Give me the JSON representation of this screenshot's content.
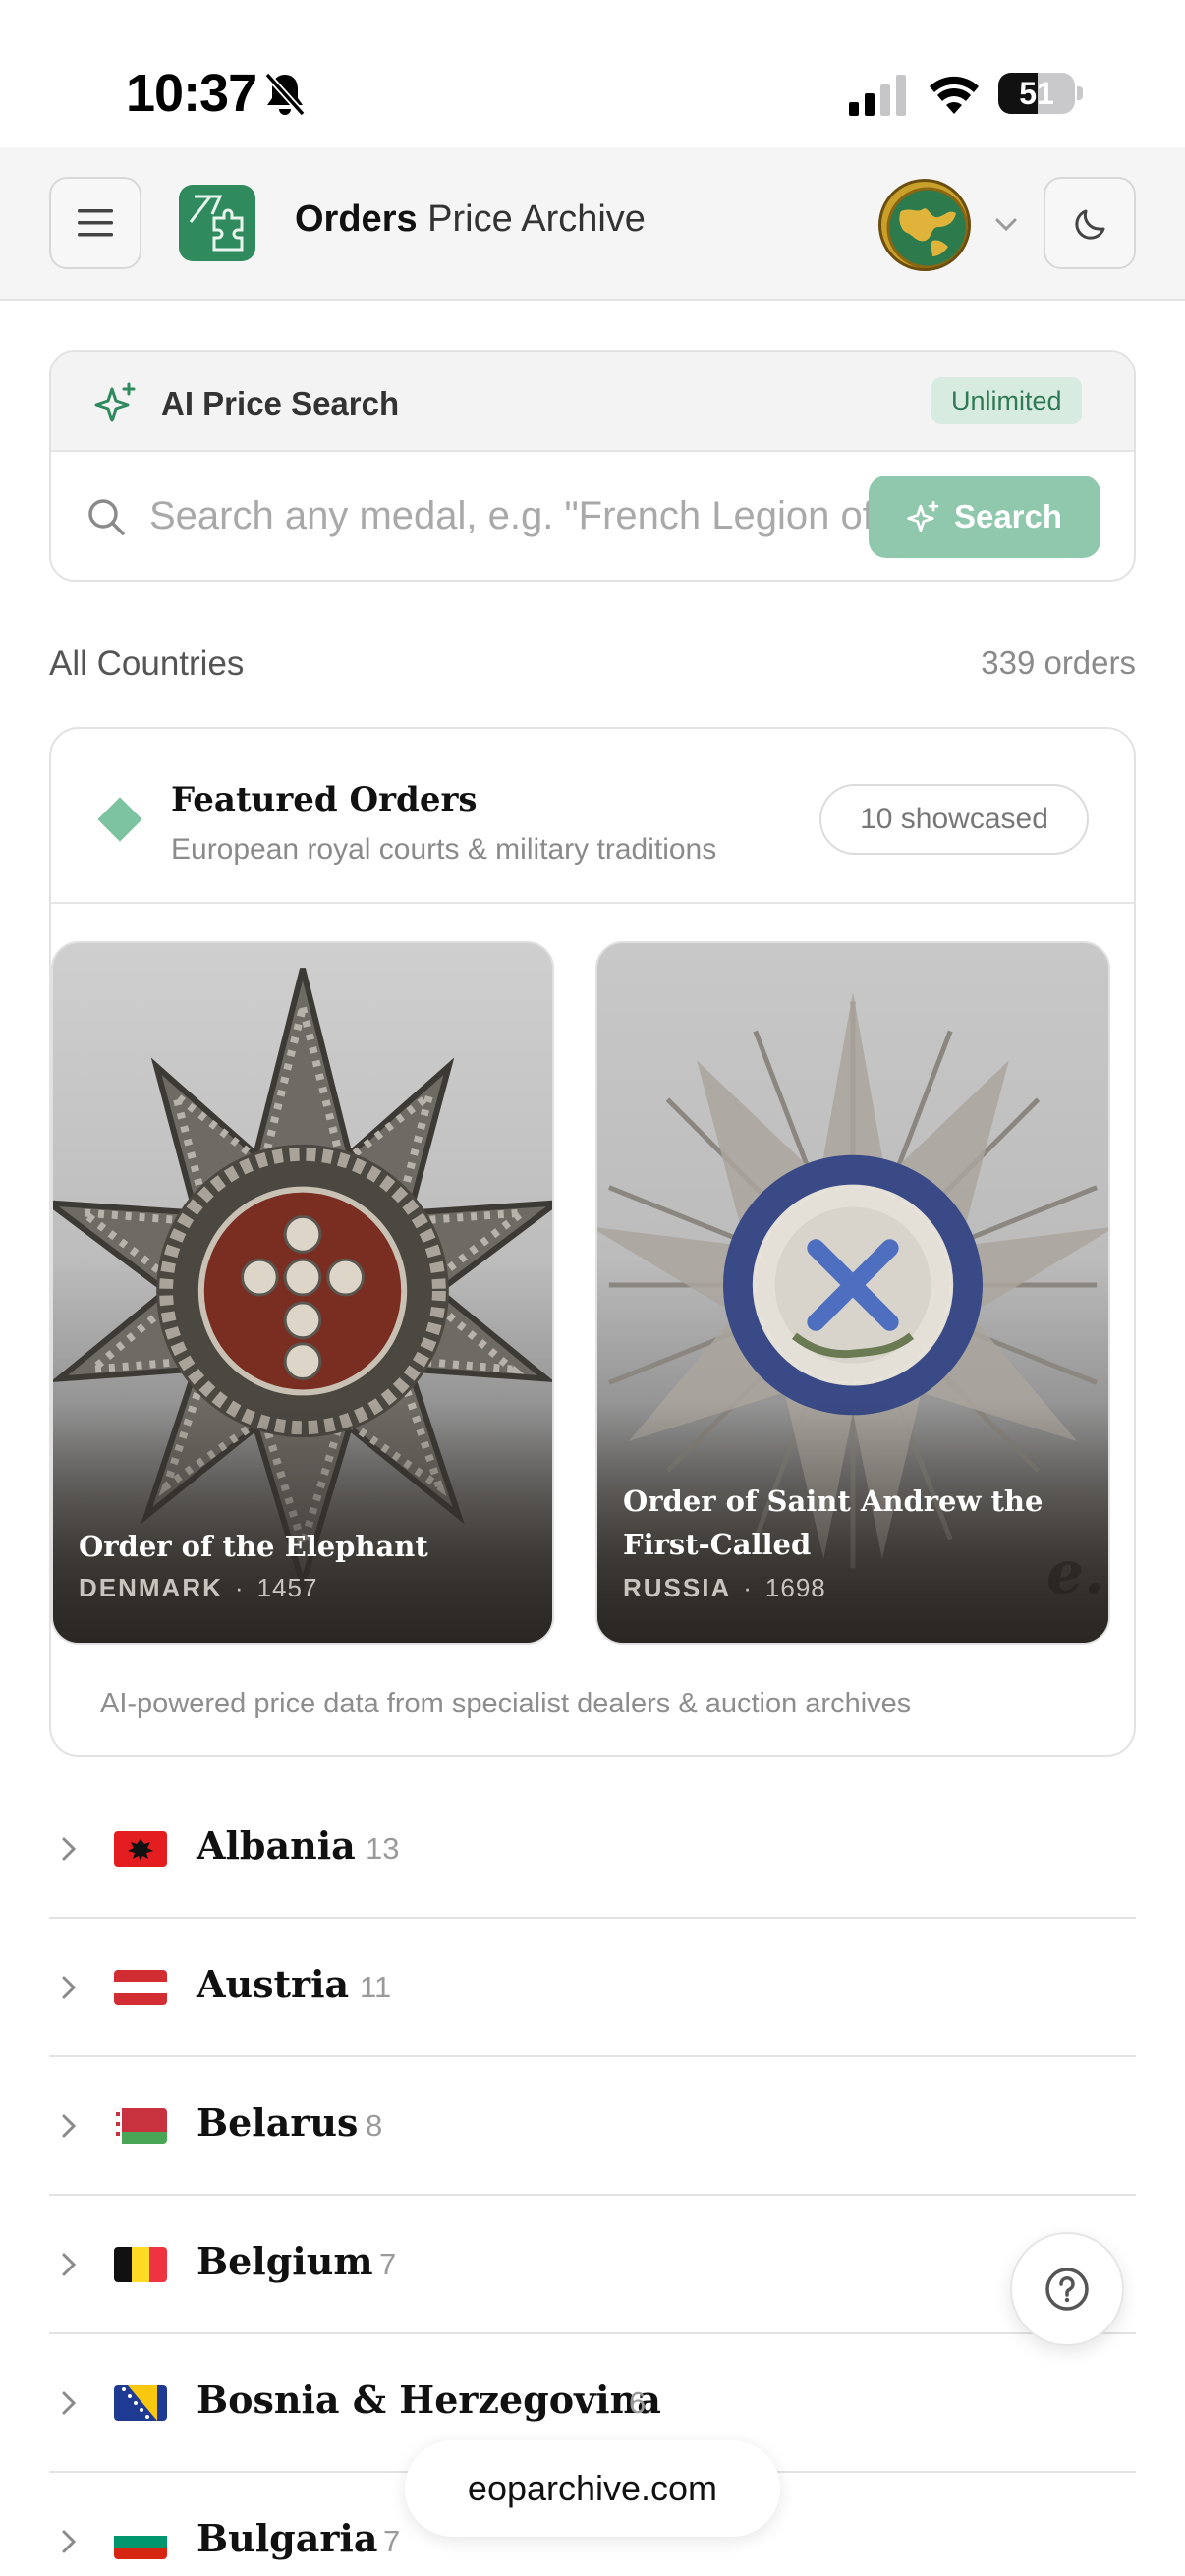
{
  "status_bar": {
    "time": "10:37",
    "battery": "51",
    "battery_level": 0.51,
    "icons": [
      "bell-slash-icon",
      "cellular-signal-icon",
      "wifi-icon",
      "battery-icon"
    ]
  },
  "header": {
    "brand_strong": "Orders",
    "brand_light": " Price Archive",
    "icons": [
      "menu-icon",
      "puzzle-logo-icon",
      "globe-avatar-icon",
      "chevron-down-icon",
      "moon-icon"
    ]
  },
  "ai_search": {
    "title": "AI Price Search",
    "badge": "Unlimited",
    "placeholder": "Search any medal, e.g. \"French Legion of Honour\"",
    "value": "",
    "button": "Search"
  },
  "summary": {
    "scope": "All Countries",
    "count": "339 orders"
  },
  "featured": {
    "title": "Featured Orders",
    "subtitle": "European royal courts & military traditions",
    "pill": "10 showcased",
    "footnote": "AI-powered price data from specialist dealers & auction archives",
    "items": [
      {
        "name": "Order of the Elephant",
        "country": "DENMARK",
        "year": "1457"
      },
      {
        "name": "Order of Saint Andrew the First-Called",
        "country": "RUSSIA",
        "year": "1698"
      }
    ],
    "watermark": "e."
  },
  "countries": [
    {
      "name": "Albania",
      "count": "13"
    },
    {
      "name": "Austria",
      "count": "11"
    },
    {
      "name": "Belarus",
      "count": "8"
    },
    {
      "name": "Belgium",
      "count": "7"
    },
    {
      "name": "Bosnia & Herzegovina",
      "count": "6"
    },
    {
      "name": "Bulgaria",
      "count": "7"
    }
  ],
  "colors": {
    "accent": "#2f8a5e",
    "search_button": "#8fc8ad",
    "badge_bg": "#d7ebe0",
    "badge_text": "#2f7a55"
  },
  "domain": "eoparchive.com"
}
